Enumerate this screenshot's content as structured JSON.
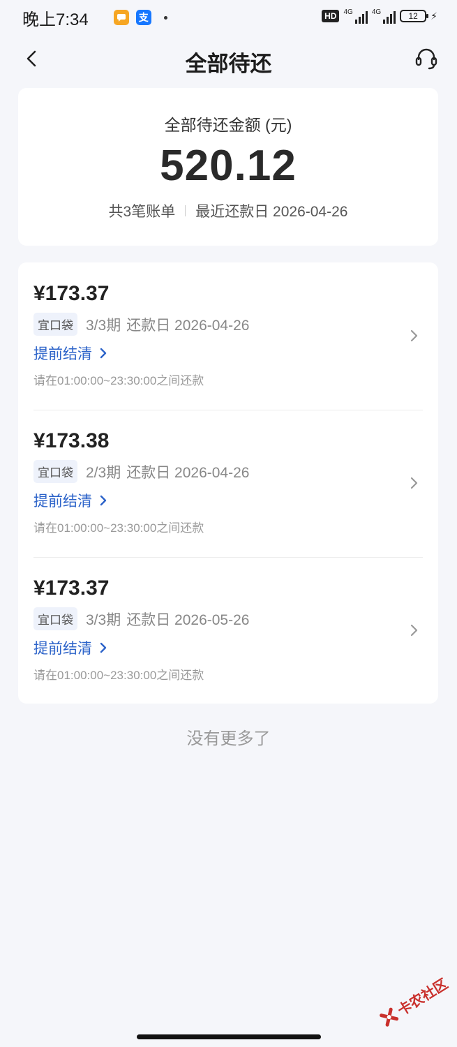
{
  "status_bar": {
    "time": "晚上7:34",
    "notifications": [
      {
        "icon": "chat-bubble-icon",
        "color": "#f6a623"
      },
      {
        "icon": "alipay-icon",
        "glyph": "支",
        "color": "#1677ff"
      }
    ],
    "hd_label": "HD",
    "network_label": "4G",
    "battery": "12"
  },
  "header": {
    "title": "全部待还"
  },
  "summary": {
    "label": "全部待还金额 (元)",
    "amount": "520.12",
    "bill_count": "共3笔账单",
    "latest_due": "最近还款日 2026-04-26"
  },
  "bills": [
    {
      "amount": "¥173.37",
      "product": "宜口袋",
      "term": "3/3期",
      "due": "还款日 2026-04-26",
      "settle_label": "提前结清",
      "time_note": "请在01:00:00~23:30:00之间还款"
    },
    {
      "amount": "¥173.38",
      "product": "宜口袋",
      "term": "2/3期",
      "due": "还款日 2026-04-26",
      "settle_label": "提前结清",
      "time_note": "请在01:00:00~23:30:00之间还款"
    },
    {
      "amount": "¥173.37",
      "product": "宜口袋",
      "term": "3/3期",
      "due": "还款日 2026-05-26",
      "settle_label": "提前结清",
      "time_note": "请在01:00:00~23:30:00之间还款"
    }
  ],
  "footer": {
    "no_more": "没有更多了"
  },
  "watermark": {
    "text": "卡农社区"
  },
  "colors": {
    "background": "#f5f6fa",
    "link": "#2c63c9",
    "tag_bg": "#eef2fb"
  }
}
